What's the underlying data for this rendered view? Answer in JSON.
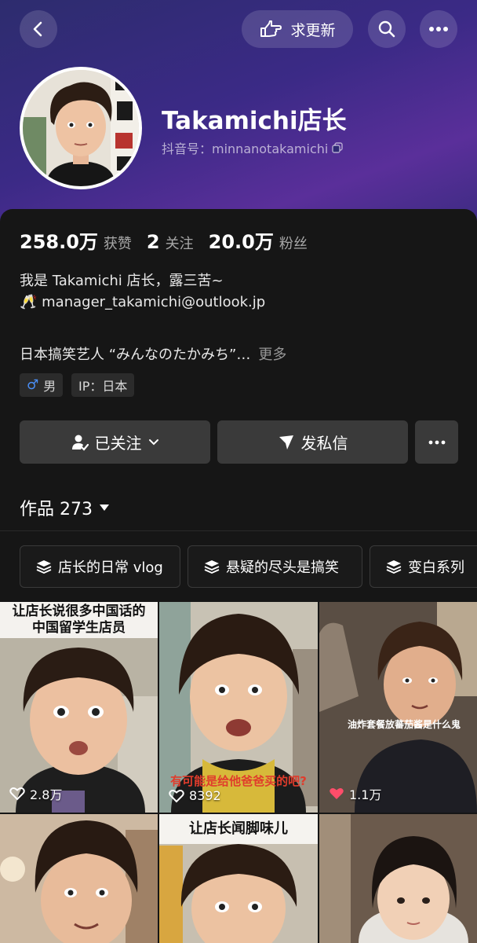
{
  "header": {
    "request_update_label": "求更新",
    "back_icon": "chevron-left-icon",
    "search_icon": "search-icon",
    "more_icon": "more-horizontal-icon"
  },
  "profile": {
    "name": "Takamichi店长",
    "id_label": "抖音号：minnanotakamichi",
    "stats": {
      "likes_num": "258.0万",
      "likes_label": "获赞",
      "following_num": "2",
      "following_label": "关注",
      "followers_num": "20.0万",
      "followers_label": "粉丝"
    },
    "bio_line1": "我是 Takamichi 店长，露三苦~",
    "bio_line2": "🥂 manager_takamichi@outlook.jp",
    "bio_line3": "日本搞笑艺人 “みんなのたかみち”…",
    "more_label": "更多",
    "gender_label": "男",
    "ip_label": "IP：日本"
  },
  "actions": {
    "followed_label": "已关注",
    "message_label": "发私信"
  },
  "works": {
    "label": "作品 273"
  },
  "collections": [
    {
      "label": "店长的日常 vlog"
    },
    {
      "label": "悬疑的尽头是搞笑"
    },
    {
      "label": "变白系列"
    }
  ],
  "videos": [
    {
      "caption": "让店长说很多中国话的\n中国留学生店员",
      "likes": "2.8万"
    },
    {
      "caption": "有可能是给他爸爸买的吧?",
      "likes": "8392"
    },
    {
      "caption": "油炸套餐放蕃茄酱是什么鬼",
      "likes": "1.1万"
    },
    {
      "caption": "",
      "likes": ""
    },
    {
      "caption": "让店长闻脚味儿",
      "likes": ""
    },
    {
      "caption": "",
      "likes": ""
    }
  ],
  "colors": {
    "accent_blue": "#4a8ff7",
    "heart_red": "#ff4d6a"
  }
}
